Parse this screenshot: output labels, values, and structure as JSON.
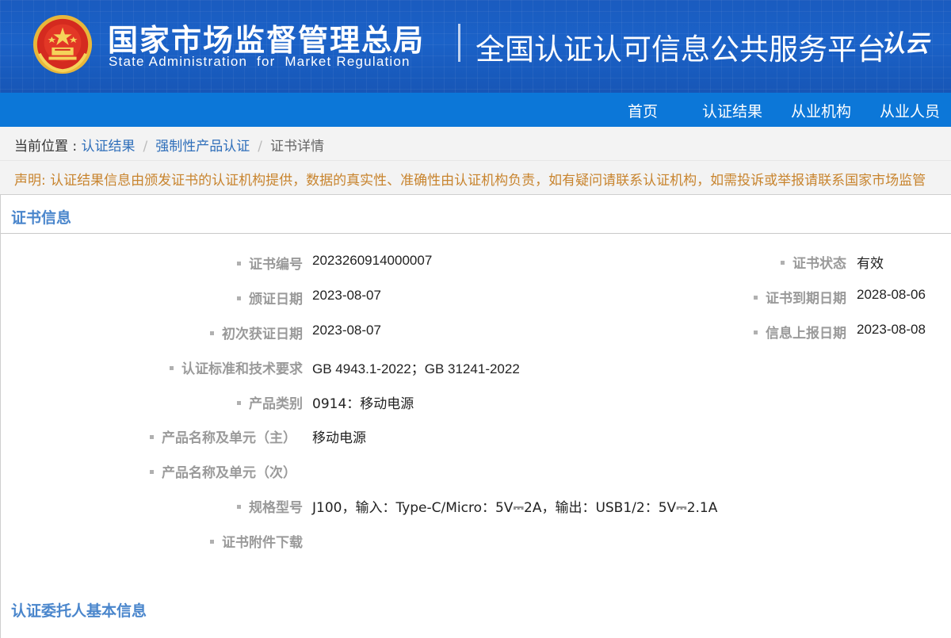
{
  "header": {
    "org_cn": "国家市场监督管理总局",
    "org_en": "State Administration  for  Market Regulation",
    "platform": "全国认证认可信息公共服务平台",
    "logo_text": "认云"
  },
  "nav": {
    "items": [
      "首页",
      "认证结果",
      "从业机构",
      "从业人员"
    ]
  },
  "breadcrumb": {
    "prefix": "当前位置 :",
    "items": [
      "认证结果",
      "强制性产品认证",
      "证书详情"
    ]
  },
  "notice": "声明: 认证结果信息由颁发证书的认证机构提供，数据的真实性、准确性由认证机构负责，如有疑问请联系认证机构，如需投诉或举报请联系国家市场监管",
  "sections": {
    "cert_info_title": "证书信息",
    "client_info_title": "认证委托人基本信息"
  },
  "cert": {
    "left": [
      {
        "label": "证书编号",
        "value": "2023260914000007"
      },
      {
        "label": "颁证日期",
        "value": "2023-08-07"
      },
      {
        "label": "初次获证日期",
        "value": "2023-08-07"
      },
      {
        "label": "认证标准和技术要求",
        "value": "GB 4943.1-2022；GB 31241-2022"
      },
      {
        "label": "产品类别",
        "value": "0914：移动电源"
      },
      {
        "label": "产品名称及单元（主）",
        "value": "移动电源"
      },
      {
        "label": "产品名称及单元（次）",
        "value": ""
      },
      {
        "label": "规格型号",
        "value": "J100，输入：Type-C/Micro：5V⎓2A，输出：USB1/2：5V⎓2.1A"
      },
      {
        "label": "证书附件下载",
        "value": ""
      }
    ],
    "right": [
      {
        "label": "证书状态",
        "value": "有效"
      },
      {
        "label": "证书到期日期",
        "value": "2028-08-06"
      },
      {
        "label": "信息上报日期",
        "value": "2023-08-08"
      }
    ]
  },
  "colors": {
    "banner": "#1b62c8",
    "nav": "#0c77d8",
    "section_title": "#4a86cc",
    "notice": "#c8842e"
  }
}
